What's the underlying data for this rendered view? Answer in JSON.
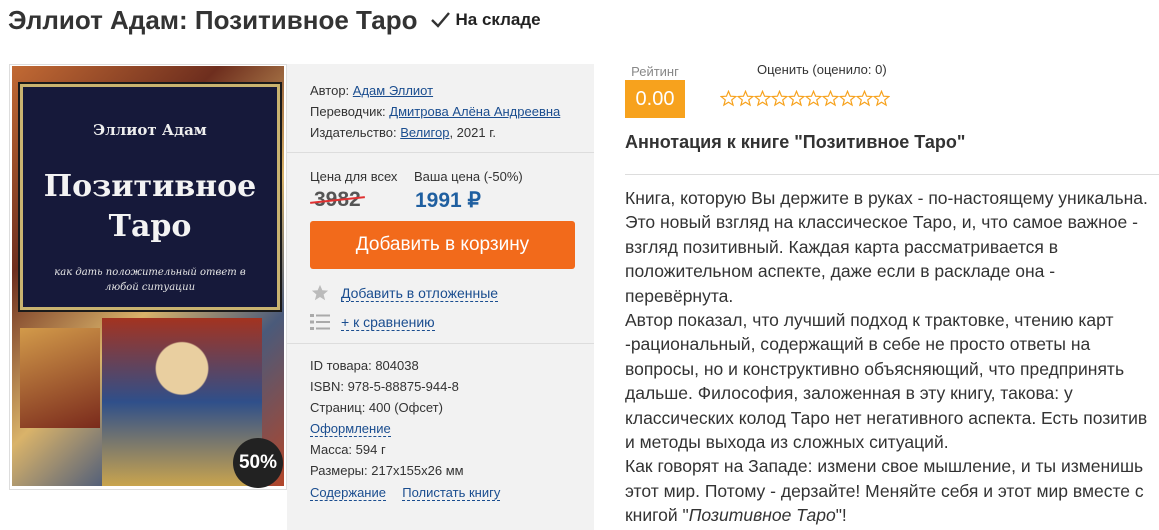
{
  "header": {
    "title": "Эллиот Адам: Позитивное Таро",
    "stock": "На складе"
  },
  "cover": {
    "author": "Эллиот Адам",
    "title_line1": "Позитивное",
    "title_line2": "Таро",
    "subtitle": "как дать положительный ответ в любой ситуации",
    "discount_badge": "50%"
  },
  "details": {
    "author_label": "Автор:",
    "author": "Адам Эллиот",
    "translator_label": "Переводчик:",
    "translator": "Дмитрова Алёна Андреевна",
    "publisher_label": "Издательство:",
    "publisher": "Велигор",
    "publisher_year": ", 2021 г."
  },
  "price": {
    "regular_label": "Цена для всех",
    "your_label": "Ваша цена (-50%)",
    "old": "3982",
    "new": "1991 ₽"
  },
  "actions": {
    "add_to_cart": "Добавить в корзину",
    "wishlist": "Добавить в отложенные",
    "compare": "+ к сравнению"
  },
  "specs": {
    "id": "ID товара: 804038",
    "isbn": "ISBN: 978-5-88875-944-8",
    "pages": "Страниц: 400 (Офсет)",
    "design": "Оформление",
    "weight": "Масса: 594 г",
    "size": "Размеры: 217x155x26 мм",
    "contents": "Содержание",
    "browse": "Полистать книгу"
  },
  "rating": {
    "label": "Рейтинг",
    "value": "0.00",
    "rate_caption": "Оценить (оценило: 0)",
    "stars_count": 10,
    "star_color": "#f7a21d"
  },
  "annotation": {
    "title": "Аннотация к книге \"Позитивное Таро\"",
    "p1": "Книга, которую Вы держите в руках - по-настоящему уникальна. Это новый взгляд на классическое Таро, и, что самое важное - взгляд позитивный. Каждая карта рассматривается в положительном аспекте, даже если в раскладе она - перевёрнута.",
    "p2": "Автор показал, что лучший подход к трактовке, чтению карт -рациональный, содержащий в себе не просто ответы на вопросы, но и конструктивно объясняющий, что предпринять дальше. Философия, заложенная в эту книгу, такова: у классических колод Таро нет негативного аспекта. Есть позитив и методы выхода из сложных ситуаций.",
    "p3_start": "Как говорят на Западе: измени свое мышление, и ты изменишь этот мир. Потому - дерзайте! Меняйте себя и этот мир вместе с книгой \"",
    "p3_italic": "Позитивное Таро",
    "p3_end": "\"!"
  }
}
